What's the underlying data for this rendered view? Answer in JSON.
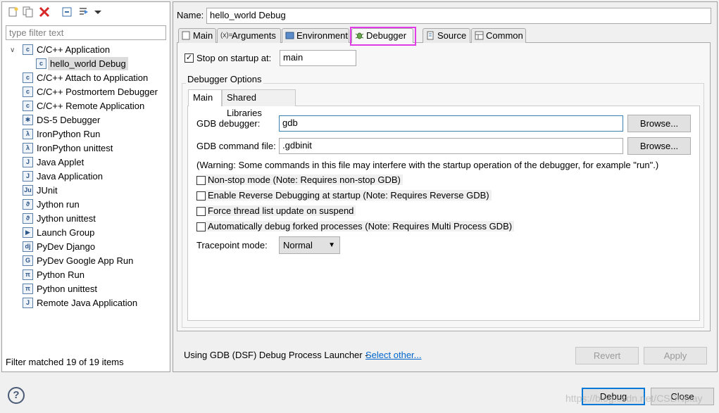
{
  "left": {
    "filter_placeholder": "type filter text",
    "tree": [
      {
        "label": "C/C++ Application",
        "icon": "c-app-icon"
      },
      {
        "label": "hello_world Debug",
        "icon": "c-app-icon"
      },
      {
        "label": "C/C++ Attach to Application",
        "icon": "c-app-icon"
      },
      {
        "label": "C/C++ Postmortem Debugger",
        "icon": "c-app-icon"
      },
      {
        "label": "C/C++ Remote Application",
        "icon": "c-app-icon"
      },
      {
        "label": "DS-5 Debugger",
        "icon": "ds5-icon"
      },
      {
        "label": "IronPython Run",
        "icon": "ironpython-icon"
      },
      {
        "label": "IronPython unittest",
        "icon": "ironpython-unittest-icon"
      },
      {
        "label": "Java Applet",
        "icon": "java-applet-icon"
      },
      {
        "label": "Java Application",
        "icon": "java-app-icon"
      },
      {
        "label": "JUnit",
        "icon": "junit-icon"
      },
      {
        "label": "Jython run",
        "icon": "jython-icon"
      },
      {
        "label": "Jython unittest",
        "icon": "jython-unittest-icon"
      },
      {
        "label": "Launch Group",
        "icon": "launch-group-icon"
      },
      {
        "label": "PyDev Django",
        "icon": "django-icon"
      },
      {
        "label": "PyDev Google App Run",
        "icon": "google-app-icon"
      },
      {
        "label": "Python Run",
        "icon": "python-icon"
      },
      {
        "label": "Python unittest",
        "icon": "python-unittest-icon"
      },
      {
        "label": "Remote Java Application",
        "icon": "remote-java-icon"
      }
    ],
    "status": "Filter matched 19 of 19 items"
  },
  "right": {
    "name_label": "Name:",
    "name_value": "hello_world Debug",
    "tabs": [
      {
        "label": "Main"
      },
      {
        "label": "Arguments"
      },
      {
        "label": "Environment"
      },
      {
        "label": "Debugger"
      },
      {
        "label": "Source"
      },
      {
        "label": "Common"
      }
    ],
    "stop_on_startup_label": "Stop on startup at:",
    "stop_on_startup_checked": true,
    "stop_on_startup_value": "main",
    "debugger_options_title": "Debugger Options",
    "subtabs": [
      {
        "label": "Main"
      },
      {
        "label": "Shared Libraries"
      }
    ],
    "gdb_debugger_label": "GDB debugger:",
    "gdb_debugger_value": "gdb",
    "gdb_command_file_label": "GDB command file:",
    "gdb_command_file_value": ".gdbinit",
    "browse_label": "Browse...",
    "warning": "(Warning: Some commands in this file may interfere with the startup operation of the debugger, for example \"run\".)",
    "options": [
      {
        "label": "Non-stop mode (Note: Requires non-stop GDB)",
        "checked": false
      },
      {
        "label": "Enable Reverse Debugging at startup (Note: Requires Reverse GDB)",
        "checked": false
      },
      {
        "label": "Force thread list update on suspend",
        "checked": false
      },
      {
        "label": "Automatically debug forked processes (Note: Requires Multi Process GDB)",
        "checked": false
      }
    ],
    "tracepoint_label": "Tracepoint mode:",
    "tracepoint_value": "Normal",
    "launcher_text": "Using GDB (DSF) Debug Process Launcher -",
    "select_other": "Select other...",
    "revert_label": "Revert",
    "apply_label": "Apply"
  },
  "footer": {
    "debug_label": "Debug",
    "close_label": "Close",
    "watermark": "https://blog.csdn.net/CSDNplay"
  },
  "colors": {
    "highlight": "#e23be8",
    "link": "#0066cc",
    "focus": "#3c7fb1"
  }
}
